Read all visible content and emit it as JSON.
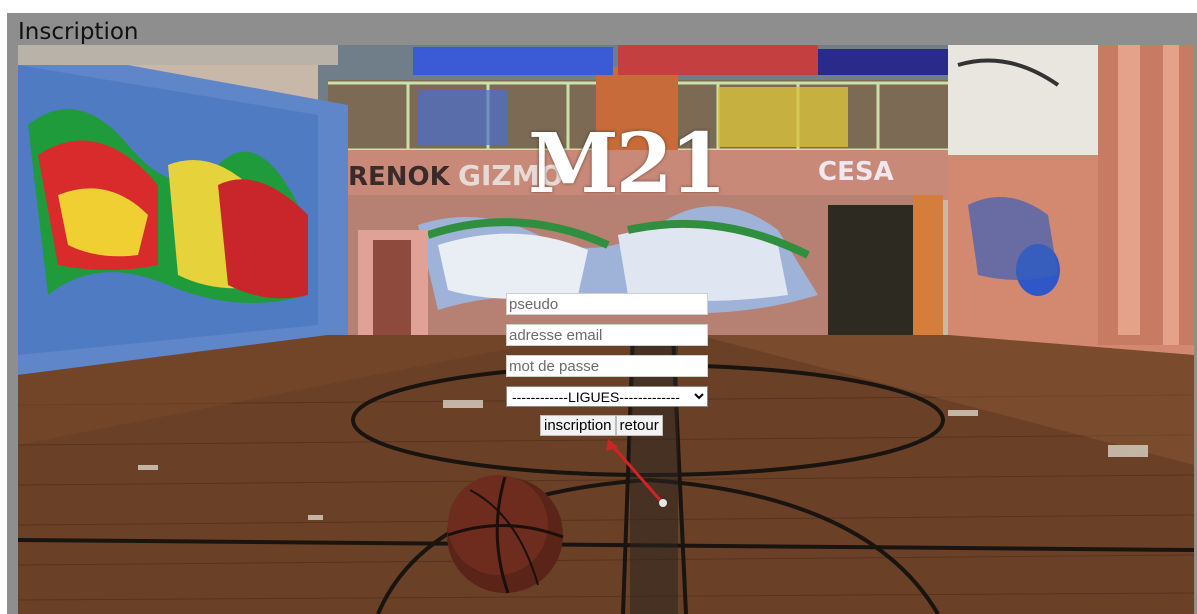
{
  "window": {
    "title": "Inscription"
  },
  "logo": {
    "text": "M21"
  },
  "form": {
    "pseudo_placeholder": "pseudo",
    "email_placeholder": "adresse email",
    "password_placeholder": "mot de passe",
    "ligues_selected": "------------LIGUES-------------",
    "signup_label": "inscription",
    "back_label": "retour"
  },
  "colors": {
    "frame": "#8e8e8e",
    "floor": "#6a4126",
    "wall_pink": "#c98978",
    "logo": "#ffffff"
  }
}
